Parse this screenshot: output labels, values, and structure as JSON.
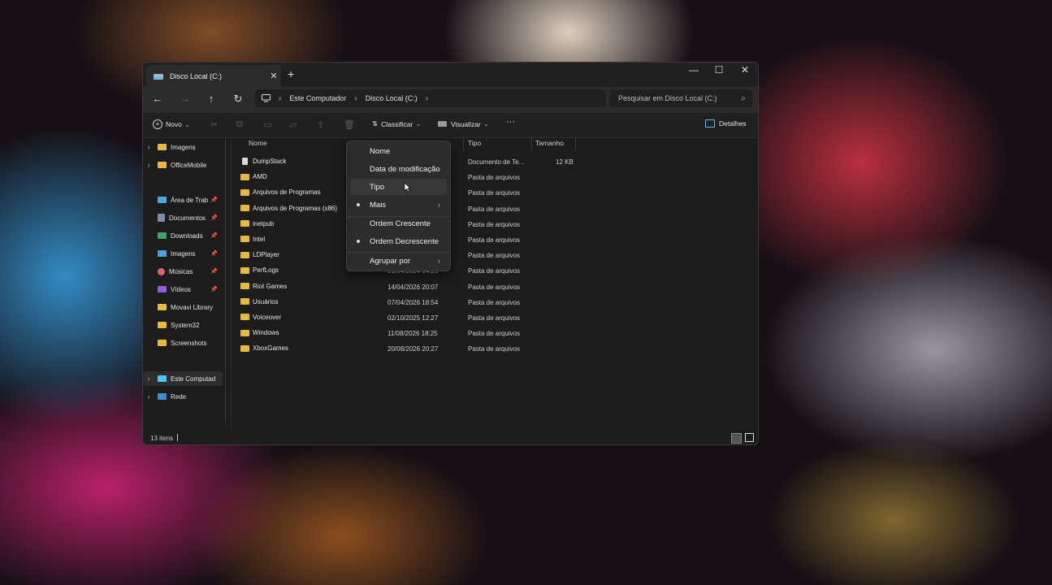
{
  "window": {
    "tab_title": "Disco Local (C:)",
    "close_tab": "✕",
    "new_tab": "+",
    "minimize": "—",
    "maximize": "☐",
    "close": "✕"
  },
  "address": {
    "back": "←",
    "forward": "→",
    "up": "↑",
    "refresh": "↻",
    "breadcrumb": [
      "Este Computador",
      "Disco Local (C:)"
    ],
    "separator": "›",
    "search_placeholder": "Pesquisar em Disco Local (C:)",
    "search_icon": "⌕"
  },
  "toolbar": {
    "new_label": "Novo",
    "sort_label": "Classificar",
    "view_label": "Visualizar",
    "more_label": "···",
    "details_label": "Detalhes",
    "chevron": "⌄"
  },
  "sidebar": {
    "items": [
      {
        "label": "Imagens",
        "icon": "folder-icon",
        "chevron": "›",
        "pinned": false
      },
      {
        "label": "OfficeMobile",
        "icon": "folder-icon",
        "chevron": "›",
        "pinned": false
      },
      {
        "label": "Área de Trab",
        "icon": "desktop-icon",
        "chevron": "",
        "pinned": true
      },
      {
        "label": "Documentos",
        "icon": "document-icon",
        "chevron": "",
        "pinned": true
      },
      {
        "label": "Downloads",
        "icon": "download-icon",
        "chevron": "",
        "pinned": true
      },
      {
        "label": "Imagens",
        "icon": "pictures-icon",
        "chevron": "",
        "pinned": true
      },
      {
        "label": "Músicas",
        "icon": "music-icon",
        "chevron": "",
        "pinned": true
      },
      {
        "label": "Vídeos",
        "icon": "video-icon",
        "chevron": "",
        "pinned": true
      },
      {
        "label": "Movavi Library",
        "icon": "folder-icon",
        "chevron": "",
        "pinned": false
      },
      {
        "label": "System32",
        "icon": "folder-icon",
        "chevron": "",
        "pinned": false
      },
      {
        "label": "Screenshots",
        "icon": "folder-icon",
        "chevron": "",
        "pinned": false
      },
      {
        "label": "Este Computad",
        "icon": "computer-icon",
        "chevron": "›",
        "pinned": false
      },
      {
        "label": "Rede",
        "icon": "network-icon",
        "chevron": "›",
        "pinned": false
      }
    ],
    "pin_glyph": "📌"
  },
  "columns": {
    "name": "Nome",
    "type": "Tipo",
    "size": "Tamanho"
  },
  "files": [
    {
      "name": "DumpStack",
      "date": "",
      "type": "Documento de Te...",
      "size": "12 KB",
      "kind": "doc"
    },
    {
      "name": "AMD",
      "date": "",
      "type": "Pasta de arquivos",
      "size": "",
      "kind": "folder"
    },
    {
      "name": "Arquivos de Programas",
      "date": "",
      "type": "Pasta de arquivos",
      "size": "",
      "kind": "folder"
    },
    {
      "name": "Arquivos de Programas (x86)",
      "date": "",
      "type": "Pasta de arquivos",
      "size": "",
      "kind": "folder"
    },
    {
      "name": "inetpub",
      "date": "",
      "type": "Pasta de arquivos",
      "size": "",
      "kind": "folder"
    },
    {
      "name": "Intel",
      "date": "",
      "type": "Pasta de arquivos",
      "size": "",
      "kind": "folder"
    },
    {
      "name": "LDPlayer",
      "date": "",
      "type": "Pasta de arquivos",
      "size": "",
      "kind": "folder"
    },
    {
      "name": "PerfLogs",
      "date": "01/04/2024 04:26",
      "type": "Pasta de arquivos",
      "size": "",
      "kind": "folder"
    },
    {
      "name": "Riot Games",
      "date": "14/04/2026 20:07",
      "type": "Pasta de arquivos",
      "size": "",
      "kind": "folder"
    },
    {
      "name": "Usuários",
      "date": "07/04/2026 18:54",
      "type": "Pasta de arquivos",
      "size": "",
      "kind": "folder"
    },
    {
      "name": "Voiceover",
      "date": "02/10/2025 12:27",
      "type": "Pasta de arquivos",
      "size": "",
      "kind": "folder"
    },
    {
      "name": "Windows",
      "date": "11/08/2026 18:25",
      "type": "Pasta de arquivos",
      "size": "",
      "kind": "folder"
    },
    {
      "name": "XboxGames",
      "date": "20/08/2026 20:27",
      "type": "Pasta de arquivos",
      "size": "",
      "kind": "folder"
    }
  ],
  "status": {
    "count": "13 itens"
  },
  "sort_menu": {
    "items": [
      {
        "label": "Nome",
        "dot": false,
        "arrow": ""
      },
      {
        "label": "Data de modificação",
        "dot": false,
        "arrow": ""
      },
      {
        "label": "Tipo",
        "dot": false,
        "arrow": "",
        "hover": true
      },
      {
        "label": "Mais",
        "dot": true,
        "arrow": "›"
      },
      {
        "label": "Ordem Crescente",
        "dot": false,
        "arrow": ""
      },
      {
        "label": "Ordem Decrescente",
        "dot": true,
        "arrow": ""
      },
      {
        "label": "Agrupar por",
        "dot": false,
        "arrow": "›"
      }
    ]
  },
  "colors": {
    "folder": "#e8b93a",
    "accent": "#4cc2ff"
  }
}
